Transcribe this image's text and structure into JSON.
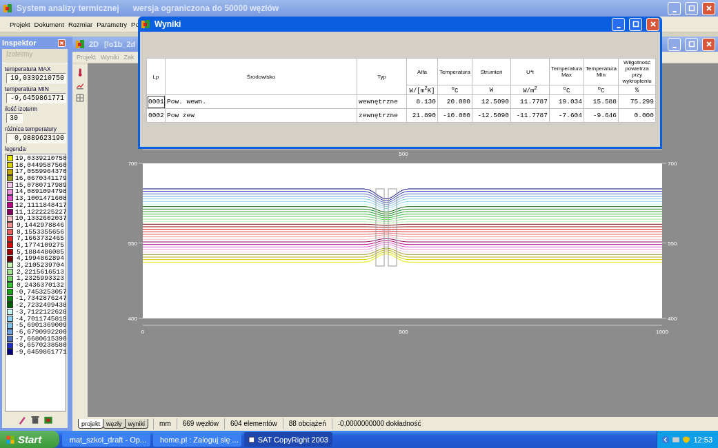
{
  "app": {
    "title": "System analizy termicznej",
    "subtitle": "wersja ograniczona do 50000 węzłów"
  },
  "menu": [
    "Projekt",
    "Dokument",
    "Rozmiar",
    "Parametry",
    "Po"
  ],
  "inspector": {
    "title": "Inspektor",
    "section": "Izotermy",
    "fields": [
      {
        "label": "temperatura MAX",
        "value": "19,0339210750",
        "kind": "long"
      },
      {
        "label": "temperatura MIN",
        "value": "-9,6459861771",
        "kind": "long"
      },
      {
        "label": "ilość izoterm",
        "value": "30",
        "kind": "count"
      },
      {
        "label": "różnica temperatury",
        "value": "0,9889623190",
        "kind": "long"
      }
    ],
    "legend_title": "legenda",
    "legend": [
      {
        "value": "19,0339210750",
        "color": "#e8e800"
      },
      {
        "value": "18,0449587560",
        "color": "#d8d000"
      },
      {
        "value": "17,0559964370",
        "color": "#c0a800"
      },
      {
        "value": "16,0670341179",
        "color": "#a0a020"
      },
      {
        "value": "15,0780717989",
        "color": "#f4c8ec"
      },
      {
        "value": "14,0891094798",
        "color": "#e890d8"
      },
      {
        "value": "13,1001471608",
        "color": "#e050c8"
      },
      {
        "value": "12,1111848417",
        "color": "#b00080"
      },
      {
        "value": "11,1222225227",
        "color": "#880060"
      },
      {
        "value": "10,1332602037",
        "color": "#f8c4c4"
      },
      {
        "value": "9,1442978846",
        "color": "#f09090"
      },
      {
        "value": "8,1553355656",
        "color": "#e86060"
      },
      {
        "value": "7,1663732465",
        "color": "#e02828"
      },
      {
        "value": "6,1774109275",
        "color": "#d00c0c"
      },
      {
        "value": "5,1884486085",
        "color": "#a00000"
      },
      {
        "value": "4,1994862894",
        "color": "#700000"
      },
      {
        "value": "3,2105239704",
        "color": "#c4f0b4"
      },
      {
        "value": "2,2215616513",
        "color": "#a0e090"
      },
      {
        "value": "1,2325993323",
        "color": "#78d068"
      },
      {
        "value": "0,2436370132",
        "color": "#38c038"
      },
      {
        "value": "-0,7453253057",
        "color": "#20a020"
      },
      {
        "value": "-1,7342876247",
        "color": "#108010"
      },
      {
        "value": "-2,7232499438",
        "color": "#006000"
      },
      {
        "value": "-3,7122122628",
        "color": "#c4f4f4"
      },
      {
        "value": "-4,7011745819",
        "color": "#90d0f0"
      },
      {
        "value": "-5,6901369009",
        "color": "#80c0e8"
      },
      {
        "value": "-6,6790992200",
        "color": "#70a0e0"
      },
      {
        "value": "-7,6680615390",
        "color": "#5070c0"
      },
      {
        "value": "-8,6570238580",
        "color": "#2030c0"
      },
      {
        "value": "-9,6459861771",
        "color": "#000080"
      }
    ]
  },
  "document": {
    "title": "2D",
    "file": "[lo1b_2d",
    "menu": [
      "Projekt",
      "Wyniki",
      "Zak"
    ],
    "plot": {
      "left_ticks": [
        "700",
        "550",
        "400"
      ],
      "right_ticks": [
        "700",
        "550",
        "400"
      ],
      "top_ticks": [
        "500"
      ],
      "bottom_ticks": [
        "0",
        "500",
        "1000"
      ]
    },
    "sheet_tabs": [
      {
        "label": "projekt",
        "selected": true
      },
      {
        "label": "węzły",
        "selected": false
      },
      {
        "label": "wyniki",
        "selected": false
      }
    ],
    "status": [
      "mm",
      "669 węzłów",
      "604 elementów",
      "88 obciążeń",
      "-0,0000000000 dokładność"
    ]
  },
  "results_dialog": {
    "title": "Wyniki",
    "columns": [
      {
        "label": "Lp"
      },
      {
        "label": "Środowisko"
      },
      {
        "label": "Typ"
      },
      {
        "label": "Alfa",
        "unit": "W/[m$^{2}$K]"
      },
      {
        "label": "Temperatura",
        "unit": "$^{o}$C"
      },
      {
        "label": "Strumień",
        "unit": "W"
      },
      {
        "label": "U*t",
        "unit": "W/m$^{2}$"
      },
      {
        "label": "Temperatura Max",
        "unit": "$^{o}$C"
      },
      {
        "label": "Temperatura Min",
        "unit": "$^{o}$C"
      },
      {
        "label": "Wilgotność powietrza przy wykropleniu",
        "unit": "%"
      }
    ],
    "rows": [
      {
        "focused": true,
        "cells": [
          "0001",
          "Pow. wewn.",
          "wewnętrzne",
          "8.130",
          "20.000",
          "12.5090",
          "11.7787",
          "19.034",
          "15.588",
          "75.299"
        ]
      },
      {
        "focused": false,
        "cells": [
          "0002",
          "Pow zew",
          "zewnętrzne",
          "21.890",
          "-10.000",
          "-12.5090",
          "-11.7787",
          "-7.604",
          "-9.646",
          "0.000"
        ]
      }
    ]
  },
  "taskbar": {
    "start": "Start",
    "tasks": [
      {
        "label": "mat_szkol_draft - Op...",
        "selected": false
      },
      {
        "label": "home.pl : Zaloguj się ...",
        "selected": false
      },
      {
        "label": "SAT CopyRight 2003",
        "selected": true
      }
    ],
    "clock": "12:53"
  }
}
